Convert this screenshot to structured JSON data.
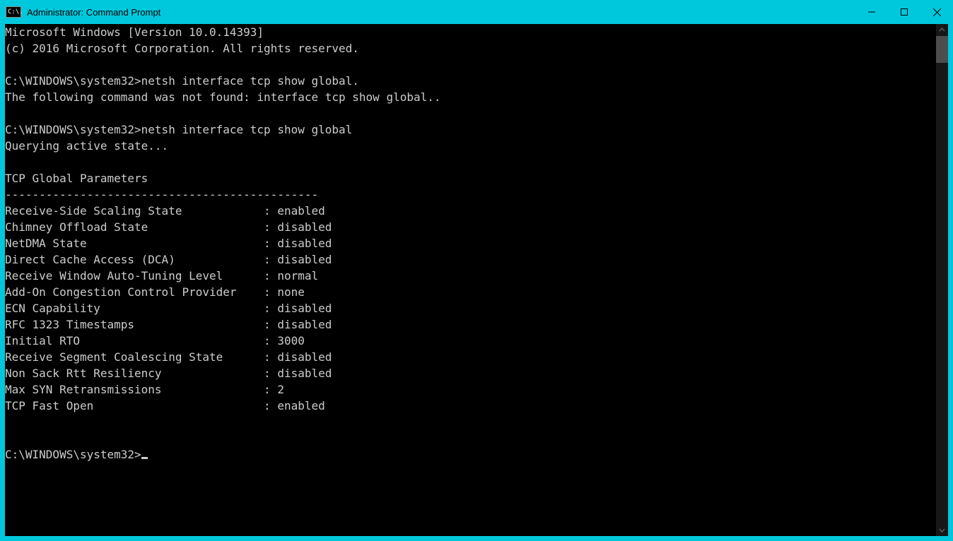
{
  "window": {
    "title": "Administrator: Command Prompt",
    "icon_text": "C:\\."
  },
  "colors": {
    "titlebar_bg": "#00c8dc",
    "client_bg": "#000000",
    "text": "#cccccc"
  },
  "terminal": {
    "banner_line1": "Microsoft Windows [Version 10.0.14393]",
    "banner_line2": "(c) 2016 Microsoft Corporation. All rights reserved.",
    "prompt_path": "C:\\WINDOWS\\system32>",
    "cmd1": "netsh interface tcp show global.",
    "cmd1_err": "The following command was not found: interface tcp show global..",
    "cmd2": "netsh interface tcp show global",
    "querying": "Querying active state...",
    "params_header": "TCP Global Parameters",
    "params_divider": "----------------------------------------------",
    "params": [
      {
        "name": "Receive-Side Scaling State",
        "value": "enabled"
      },
      {
        "name": "Chimney Offload State",
        "value": "disabled"
      },
      {
        "name": "NetDMA State",
        "value": "disabled"
      },
      {
        "name": "Direct Cache Access (DCA)",
        "value": "disabled"
      },
      {
        "name": "Receive Window Auto-Tuning Level",
        "value": "normal"
      },
      {
        "name": "Add-On Congestion Control Provider",
        "value": "none"
      },
      {
        "name": "ECN Capability",
        "value": "disabled"
      },
      {
        "name": "RFC 1323 Timestamps",
        "value": "disabled"
      },
      {
        "name": "Initial RTO",
        "value": "3000"
      },
      {
        "name": "Receive Segment Coalescing State",
        "value": "disabled"
      },
      {
        "name": "Non Sack Rtt Resiliency",
        "value": "disabled"
      },
      {
        "name": "Max SYN Retransmissions",
        "value": "2"
      },
      {
        "name": "TCP Fast Open",
        "value": "enabled"
      }
    ]
  }
}
